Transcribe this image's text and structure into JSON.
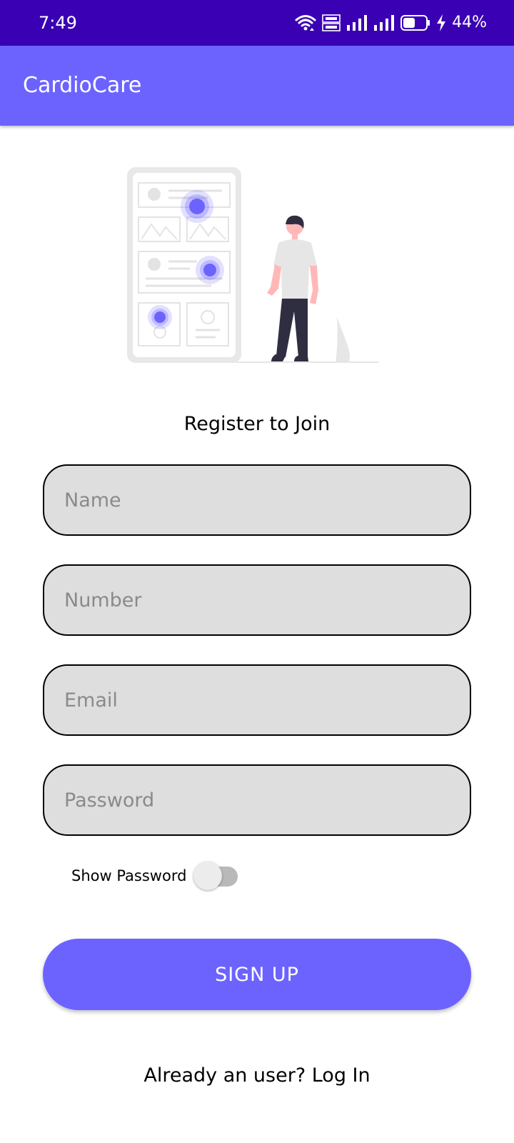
{
  "status_bar": {
    "time": "7:49",
    "battery_percent": "44%",
    "icons": [
      "wifi-icon",
      "volte-icon",
      "signal-icon",
      "signal-icon",
      "battery-icon",
      "charging-icon"
    ]
  },
  "app_bar": {
    "title": "CardioCare",
    "color": "#6c63ff"
  },
  "form": {
    "heading": "Register to Join",
    "name_placeholder": "Name",
    "number_placeholder": "Number",
    "email_placeholder": "Email",
    "password_placeholder": "Password",
    "show_password_label": "Show Password",
    "show_password_on": false,
    "signup_label": "SIGN UP"
  },
  "footer": {
    "login_text": "Already an user? Log In"
  },
  "colors": {
    "status_bar": "#3a00b4",
    "accent": "#6c63ff",
    "field_background": "#dedede"
  }
}
